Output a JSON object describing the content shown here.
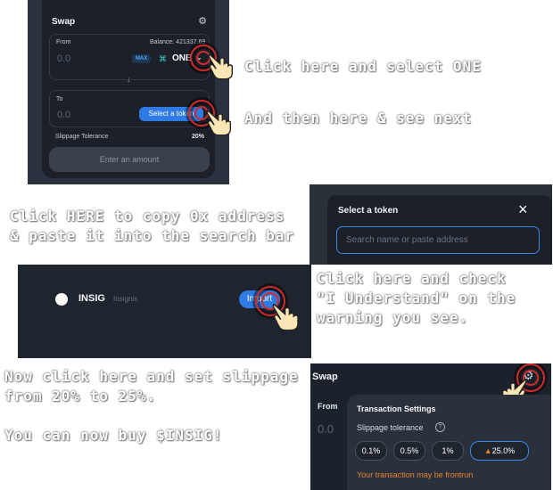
{
  "panel_swap": {
    "title": "Swap",
    "from_label": "From",
    "balance": "Balance: 421337.69",
    "from_amount": "0.0",
    "max_label": "MAX",
    "from_token": "ONE",
    "to_label": "To",
    "to_amount": "0.0",
    "select_token_label": "Select a token",
    "slippage_label": "Slippage Tolerance",
    "slippage_value": "20%",
    "enter_amount_label": "Enter an amount",
    "swap_arrow": "↓"
  },
  "captions": {
    "c1": "Click here and select ONE",
    "c2": "And then here & see next",
    "c3": "Click HERE to copy 0x address\n& paste it into the search bar",
    "c4": "Click here and check\n\"I Understand\" on the\nwarning you see.",
    "c5": "Now click here and set slippage\nfrom 20% to 25%.",
    "c6": "You can now buy $INSIG!"
  },
  "panel_select_token": {
    "title": "Select a token",
    "search_placeholder": "Search name or paste address",
    "close_icon": "×"
  },
  "panel_import": {
    "symbol": "INSIG",
    "name": "Insignis",
    "import_label": "Import"
  },
  "panel_settings": {
    "title": "Swap",
    "from_label": "From",
    "from_amount": "0.0",
    "settings_title": "Transaction Settings",
    "tolerance_label": "Slippage tolerance",
    "help_icon": "?",
    "options": [
      "0.1%",
      "0.5%",
      "1%"
    ],
    "custom_value": "25.0",
    "custom_suffix": "%",
    "warning_icon": "▲",
    "frontrun_warning": "Your transaction may be frontrun"
  },
  "colors": {
    "accent_blue": "#2f7be6",
    "target_red": "#d22a2a",
    "warning_orange": "#e58230"
  }
}
